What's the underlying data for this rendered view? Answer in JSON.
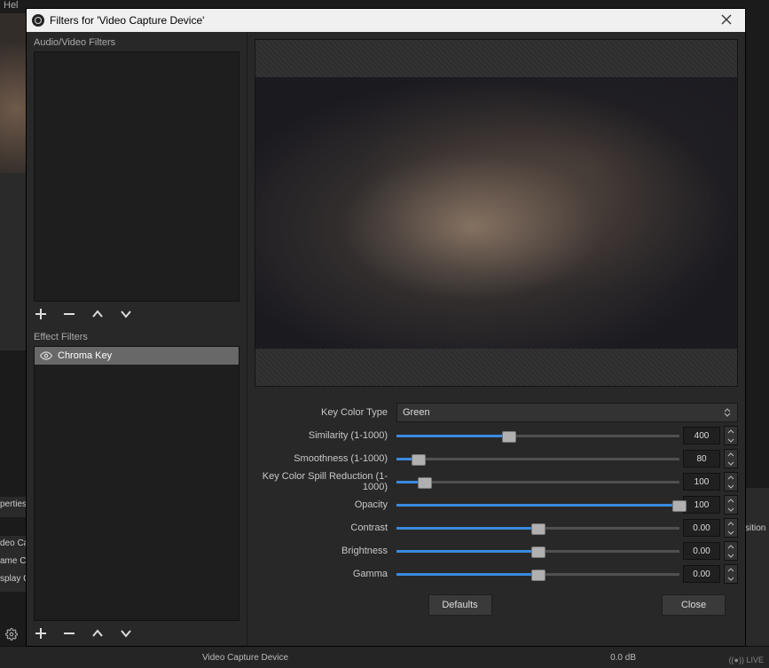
{
  "bg": {
    "menu": "Hel",
    "properties": "perties",
    "sources": [
      "deo Ca",
      "ame Ca",
      "splay C"
    ],
    "rightlbl": "sition",
    "mixer_label": "Video Capture Device",
    "db": "0.0 dB",
    "live": "((●)) LIVE"
  },
  "titlebar": {
    "title": "Filters for 'Video Capture Device'"
  },
  "sections": {
    "audio_video": "Audio/Video Filters",
    "effect": "Effect Filters"
  },
  "effect_filters": [
    {
      "label": "Chroma Key"
    }
  ],
  "properties": {
    "key_color_type": {
      "label": "Key Color Type",
      "value": "Green"
    },
    "similarity": {
      "label": "Similarity (1-1000)",
      "value": "400",
      "min": 1,
      "max": 1000,
      "num": 400
    },
    "smoothness": {
      "label": "Smoothness (1-1000)",
      "value": "80",
      "min": 1,
      "max": 1000,
      "num": 80
    },
    "spill": {
      "label": "Key Color Spill Reduction (1-1000)",
      "value": "100",
      "min": 1,
      "max": 1000,
      "num": 100
    },
    "opacity": {
      "label": "Opacity",
      "value": "100",
      "min": 0,
      "max": 100,
      "num": 100
    },
    "contrast": {
      "label": "Contrast",
      "value": "0.00",
      "min": -1,
      "max": 1,
      "num": 0
    },
    "brightness": {
      "label": "Brightness",
      "value": "0.00",
      "min": -1,
      "max": 1,
      "num": 0
    },
    "gamma": {
      "label": "Gamma",
      "value": "0.00",
      "min": -1,
      "max": 1,
      "num": 0
    }
  },
  "buttons": {
    "defaults": "Defaults",
    "close": "Close"
  }
}
